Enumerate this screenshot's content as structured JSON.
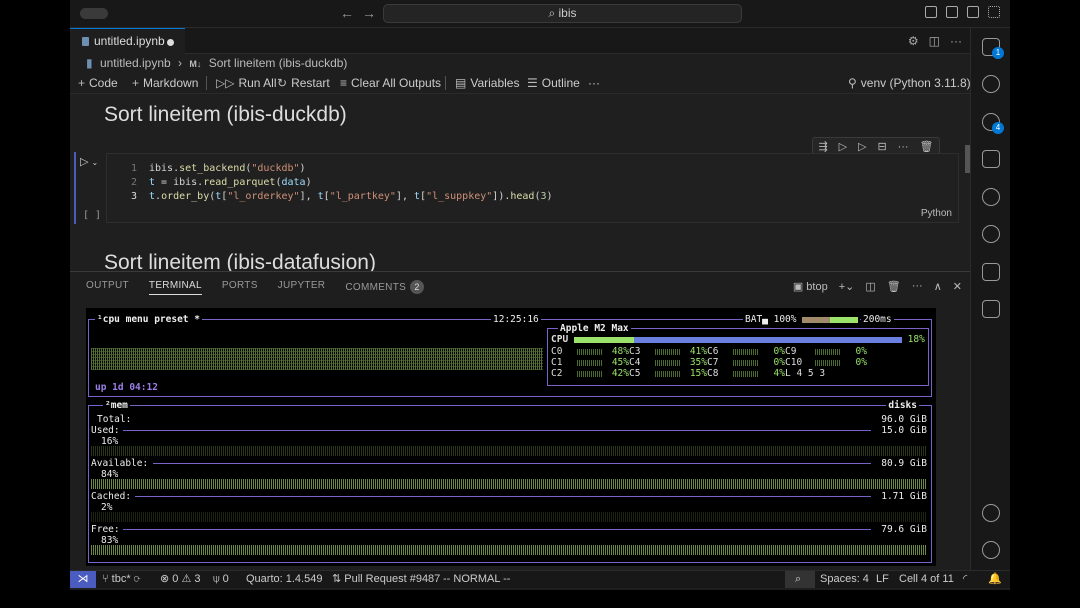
{
  "titlebar": {
    "search": "ibis"
  },
  "editor_tab": {
    "label": "untitled.ipynb"
  },
  "breadcrumb": {
    "file": "untitled.ipynb",
    "prefix": "M↓",
    "section": "Sort lineitem (ibis-duckdb)"
  },
  "toolbar": {
    "code": "Code",
    "markdown": "Markdown",
    "run_all": "Run All",
    "restart": "Restart",
    "clear": "Clear All Outputs",
    "variables": "Variables",
    "outline": "Outline",
    "more": "···",
    "kernel": "venv (Python 3.11.8)"
  },
  "notebook": {
    "heading1": "Sort lineitem (ibis-duckdb)",
    "heading2": "Sort lineitem (ibis-datafusion)",
    "cell": {
      "lines": [
        {
          "no": "1",
          "parts": [
            [
              "p",
              "ibis."
            ],
            [
              "f",
              "set_backend"
            ],
            [
              "p",
              "("
            ],
            [
              "s",
              "\"duckdb\""
            ],
            [
              "p",
              ")"
            ]
          ]
        },
        {
          "no": "2",
          "parts": [
            [
              "v",
              "t"
            ],
            [
              "p",
              " = ibis."
            ],
            [
              "f",
              "read_parquet"
            ],
            [
              "p",
              "("
            ],
            [
              "v",
              "data"
            ],
            [
              "p",
              ")"
            ]
          ]
        },
        {
          "no": "3",
          "parts": [
            [
              "v",
              "t"
            ],
            [
              "p",
              "."
            ],
            [
              "f",
              "order_by"
            ],
            [
              "p",
              "("
            ],
            [
              "v",
              "t"
            ],
            [
              "p",
              "["
            ],
            [
              "s",
              "\"l_orderkey\""
            ],
            [
              "p",
              "], "
            ],
            [
              "v",
              "t"
            ],
            [
              "p",
              "["
            ],
            [
              "s",
              "\"l_partkey\""
            ],
            [
              "p",
              "], "
            ],
            [
              "v",
              "t"
            ],
            [
              "p",
              "["
            ],
            [
              "s",
              "\"l_suppkey\""
            ],
            [
              "p",
              "])."
            ],
            [
              "f",
              "head"
            ],
            [
              "p",
              "("
            ],
            [
              "n",
              "3"
            ],
            [
              "p",
              ")"
            ]
          ]
        }
      ],
      "language": "Python",
      "exec": "[ ]"
    }
  },
  "panel": {
    "tabs": [
      "OUTPUT",
      "TERMINAL",
      "PORTS",
      "JUPYTER",
      "COMMENTS"
    ],
    "comments_count": "2",
    "terminal_name": "btop"
  },
  "btop": {
    "cpu_title": "¹cpu  menu  preset *",
    "time": "12:25:16",
    "bat": "BAT▄ 100%",
    "interval": "200ms",
    "uptime": "up 1d 04:12",
    "chip": "Apple M2 Max",
    "cpu_label": "CPU",
    "cpu_total": "18%",
    "cores": [
      [
        "C0",
        "48%",
        "C3",
        "41%",
        "C6",
        "0%",
        "C9",
        "0%"
      ],
      [
        "C1",
        "45%",
        "C4",
        "35%",
        "C7",
        "0%",
        "C10",
        "0%"
      ],
      [
        "C2",
        "42%",
        "C5",
        "15%",
        "C8",
        "4%",
        "L 4 5 3",
        ""
      ]
    ],
    "mem_title": "²mem",
    "disks_title": "disks",
    "mem": [
      {
        "label": "Total:",
        "value": "96.0 GiB",
        "pct": ""
      },
      {
        "label": "Used:",
        "value": "15.0 GiB",
        "pct": "16%"
      },
      {
        "label": "Available:",
        "value": "80.9 GiB",
        "pct": "84%"
      },
      {
        "label": "Cached:",
        "value": "1.71 GiB",
        "pct": "2%"
      },
      {
        "label": "Free:",
        "value": "79.6 GiB",
        "pct": "83%"
      }
    ]
  },
  "statusbar": {
    "branch": "tbc*",
    "errors": "0",
    "warnings": "3",
    "ports": "0",
    "quarto": "Quarto: 1.4.549",
    "pr": "Pull Request #9487",
    "mode": "-- NORMAL --",
    "spaces": "Spaces: 4",
    "eol": "LF",
    "cell": "Cell 4 of 11"
  },
  "activity_badges": {
    "explorer": "1",
    "scm": "4"
  }
}
